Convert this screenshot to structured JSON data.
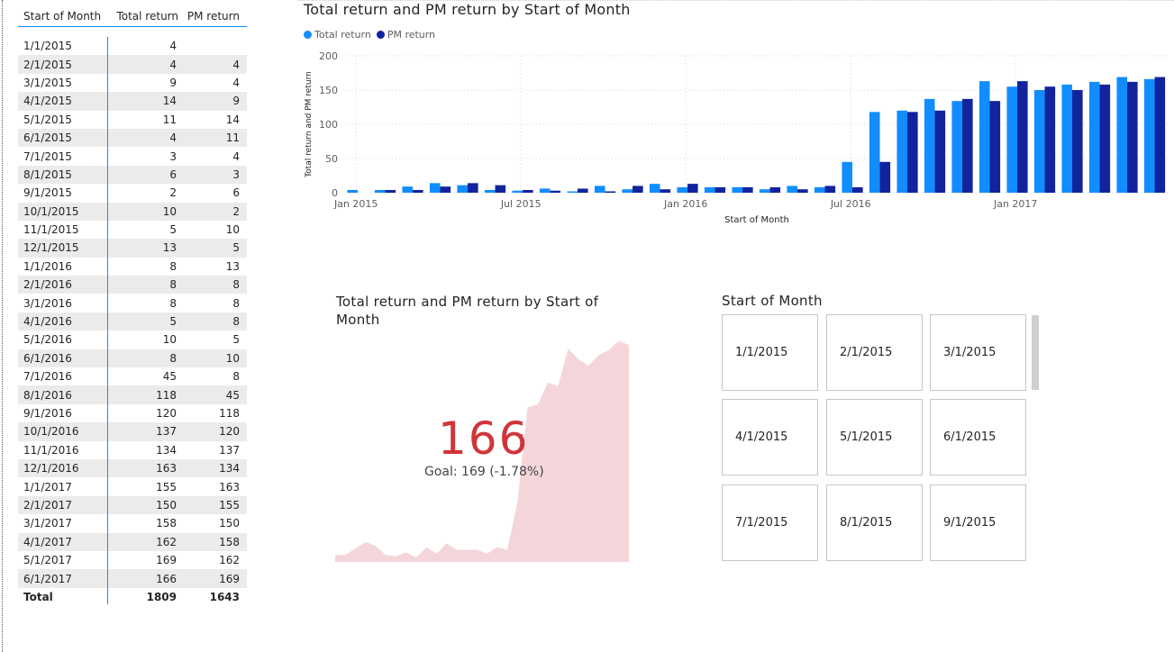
{
  "table": {
    "headers": [
      "Start of Month",
      "Total return",
      "PM return"
    ],
    "rows": [
      [
        "1/1/2015",
        "4",
        ""
      ],
      [
        "2/1/2015",
        "4",
        "4"
      ],
      [
        "3/1/2015",
        "9",
        "4"
      ],
      [
        "4/1/2015",
        "14",
        "9"
      ],
      [
        "5/1/2015",
        "11",
        "14"
      ],
      [
        "6/1/2015",
        "4",
        "11"
      ],
      [
        "7/1/2015",
        "3",
        "4"
      ],
      [
        "8/1/2015",
        "6",
        "3"
      ],
      [
        "9/1/2015",
        "2",
        "6"
      ],
      [
        "10/1/2015",
        "10",
        "2"
      ],
      [
        "11/1/2015",
        "5",
        "10"
      ],
      [
        "12/1/2015",
        "13",
        "5"
      ],
      [
        "1/1/2016",
        "8",
        "13"
      ],
      [
        "2/1/2016",
        "8",
        "8"
      ],
      [
        "3/1/2016",
        "8",
        "8"
      ],
      [
        "4/1/2016",
        "5",
        "8"
      ],
      [
        "5/1/2016",
        "10",
        "5"
      ],
      [
        "6/1/2016",
        "8",
        "10"
      ],
      [
        "7/1/2016",
        "45",
        "8"
      ],
      [
        "8/1/2016",
        "118",
        "45"
      ],
      [
        "9/1/2016",
        "120",
        "118"
      ],
      [
        "10/1/2016",
        "137",
        "120"
      ],
      [
        "11/1/2016",
        "134",
        "137"
      ],
      [
        "12/1/2016",
        "163",
        "134"
      ],
      [
        "1/1/2017",
        "155",
        "163"
      ],
      [
        "2/1/2017",
        "150",
        "155"
      ],
      [
        "3/1/2017",
        "158",
        "150"
      ],
      [
        "4/1/2017",
        "162",
        "158"
      ],
      [
        "5/1/2017",
        "169",
        "162"
      ],
      [
        "6/1/2017",
        "166",
        "169"
      ]
    ],
    "total": [
      "Total",
      "1809",
      "1643"
    ]
  },
  "bar": {
    "title": "Total return and PM return by Start of Month",
    "legend": [
      "Total return",
      "PM return"
    ]
  },
  "chart_data": {
    "type": "bar",
    "title": "Total return and PM return by Start of Month",
    "xlabel": "Start of Month",
    "ylabel": "Total return and PM return",
    "ylim": [
      0,
      200
    ],
    "yticks": [
      0,
      50,
      100,
      150,
      200
    ],
    "xtick_labels": [
      "Jan 2015",
      "Jul 2015",
      "Jan 2016",
      "Jul 2016",
      "Jan 2017"
    ],
    "grid": true,
    "legend_position": "top-left",
    "colors": {
      "Total return": "#118DFF",
      "PM return": "#12239E"
    },
    "categories": [
      "1/1/2015",
      "2/1/2015",
      "3/1/2015",
      "4/1/2015",
      "5/1/2015",
      "6/1/2015",
      "7/1/2015",
      "8/1/2015",
      "9/1/2015",
      "10/1/2015",
      "11/1/2015",
      "12/1/2015",
      "1/1/2016",
      "2/1/2016",
      "3/1/2016",
      "4/1/2016",
      "5/1/2016",
      "6/1/2016",
      "7/1/2016",
      "8/1/2016",
      "9/1/2016",
      "10/1/2016",
      "11/1/2016",
      "12/1/2016",
      "1/1/2017",
      "2/1/2017",
      "3/1/2017",
      "4/1/2017",
      "5/1/2017",
      "6/1/2017"
    ],
    "series": [
      {
        "name": "Total return",
        "values": [
          4,
          4,
          9,
          14,
          11,
          4,
          3,
          6,
          2,
          10,
          5,
          13,
          8,
          8,
          8,
          5,
          10,
          8,
          45,
          118,
          120,
          137,
          134,
          163,
          155,
          150,
          158,
          162,
          169,
          166
        ]
      },
      {
        "name": "PM return",
        "values": [
          null,
          4,
          4,
          9,
          14,
          11,
          4,
          3,
          6,
          2,
          10,
          5,
          13,
          8,
          8,
          8,
          5,
          10,
          8,
          45,
          118,
          120,
          137,
          134,
          163,
          155,
          150,
          158,
          162,
          169
        ]
      }
    ]
  },
  "kpi": {
    "title": "Total return and PM return by Start of Month",
    "value": "166",
    "goal_text": "Goal: 169 (-1.78%)",
    "status_mark": "!",
    "color": "#D13438",
    "trend_color": "#F4D6DA"
  },
  "slicer": {
    "title": "Start of Month",
    "items": [
      "1/1/2015",
      "2/1/2015",
      "3/1/2015",
      "4/1/2015",
      "5/1/2015",
      "6/1/2015",
      "7/1/2015",
      "8/1/2015",
      "9/1/2015"
    ]
  }
}
